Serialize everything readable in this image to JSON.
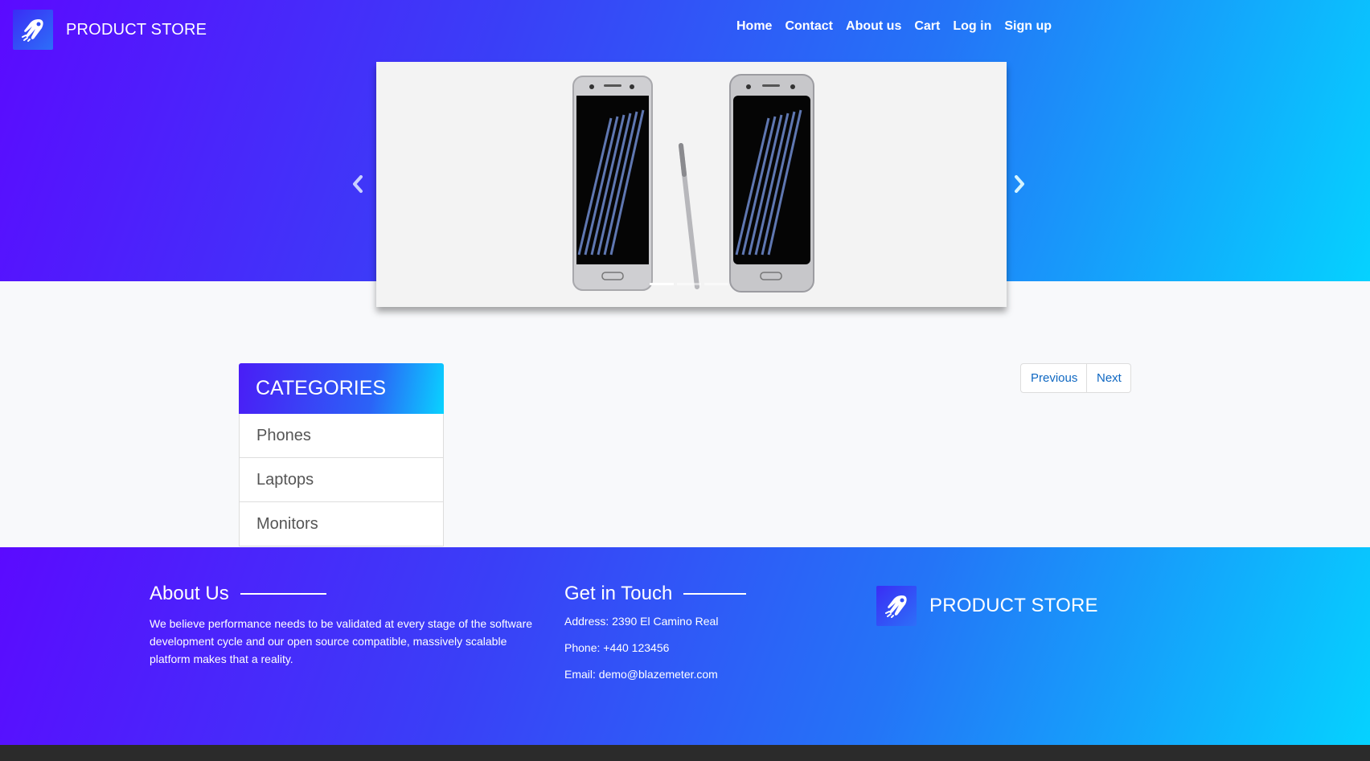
{
  "header": {
    "brand": "PRODUCT STORE",
    "nav": [
      "Home",
      "Contact",
      "About us",
      "Cart",
      "Log in",
      "Sign up"
    ]
  },
  "carousel": {
    "slide_count": 3,
    "active_index": 0
  },
  "categories": {
    "title": "CATEGORIES",
    "items": [
      "Phones",
      "Laptops",
      "Monitors"
    ]
  },
  "pagination": {
    "previous": "Previous",
    "next": "Next"
  },
  "footer": {
    "about_title": "About Us",
    "about_text": "We believe performance needs to be validated at every stage of the software development cycle and our open source compatible, massively scalable platform makes that a reality.",
    "touch_title": "Get in Touch",
    "address": "Address: 2390 El Camino Real",
    "phone": "Phone: +440 123456",
    "email": "Email: demo@blazemeter.com",
    "brand": "PRODUCT STORE"
  },
  "colors": {
    "gradient_start": "#5b0aff",
    "gradient_end": "#05d2ff",
    "link_blue": "#0f68c2",
    "bottom_bar": "#2b2b2b"
  }
}
